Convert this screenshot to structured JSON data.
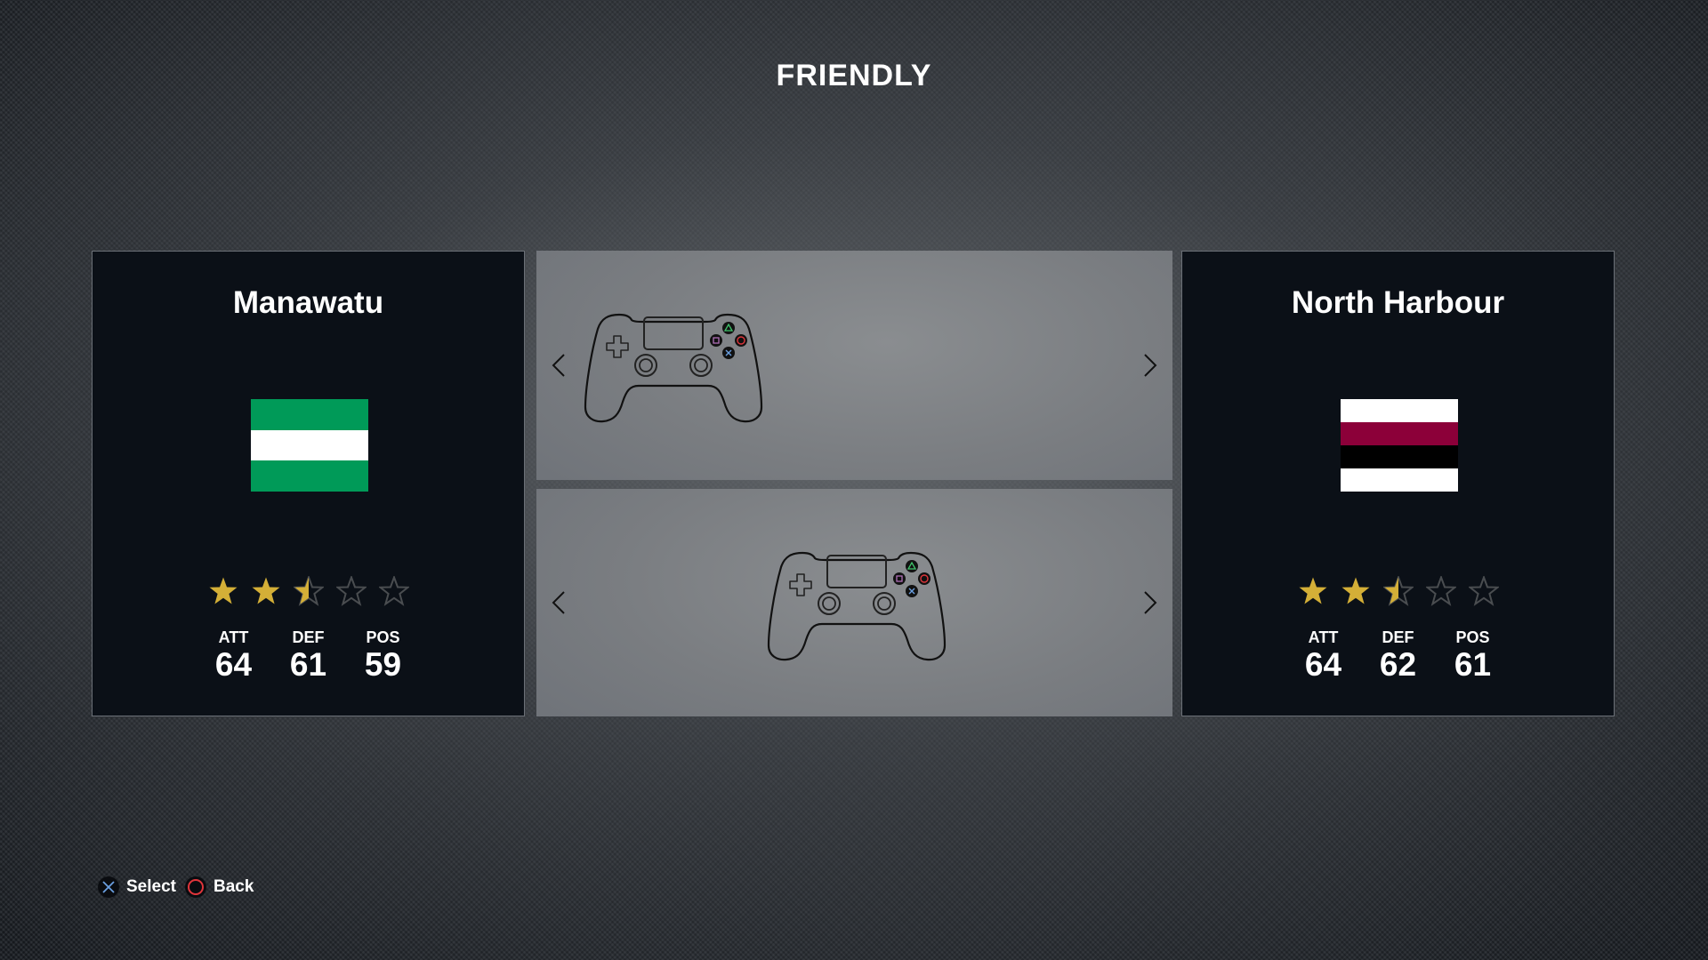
{
  "screen": {
    "title": "FRIENDLY"
  },
  "teams": [
    {
      "name": "Manawatu",
      "side": "left",
      "flag_stripes": [
        "#009a58",
        "#ffffff",
        "#009a58"
      ],
      "rating_stars": 2.5,
      "max_stars": 5,
      "stats": [
        {
          "label": "ATT",
          "value": "64"
        },
        {
          "label": "DEF",
          "value": "61"
        },
        {
          "label": "POS",
          "value": "59"
        }
      ]
    },
    {
      "name": "North Harbour",
      "side": "right",
      "flag_stripes": [
        "#ffffff",
        "#8c0039",
        "#000000",
        "#ffffff"
      ],
      "rating_stars": 2.5,
      "max_stars": 5,
      "stats": [
        {
          "label": "ATT",
          "value": "64"
        },
        {
          "label": "DEF",
          "value": "62"
        },
        {
          "label": "POS",
          "value": "61"
        }
      ]
    }
  ],
  "controllers": [
    {
      "slot": "player-1",
      "assigned_side": "left",
      "icon": "gamepad-icon"
    },
    {
      "slot": "player-2",
      "assigned_side": "center",
      "icon": "gamepad-icon"
    }
  ],
  "footer": {
    "hints": [
      {
        "icon": "cross-button-icon",
        "label": "Select",
        "color": "#6a9fe0"
      },
      {
        "icon": "circle-button-icon",
        "label": "Back",
        "color": "#e0353b"
      }
    ]
  },
  "colors": {
    "star_filled": "#d4af37",
    "star_empty": "#4a4d50",
    "panel_bg": "#0b1017",
    "triangle": "#3fc46b",
    "circle": "#e0353b",
    "cross": "#6a9fe0",
    "square": "#b070b8"
  }
}
